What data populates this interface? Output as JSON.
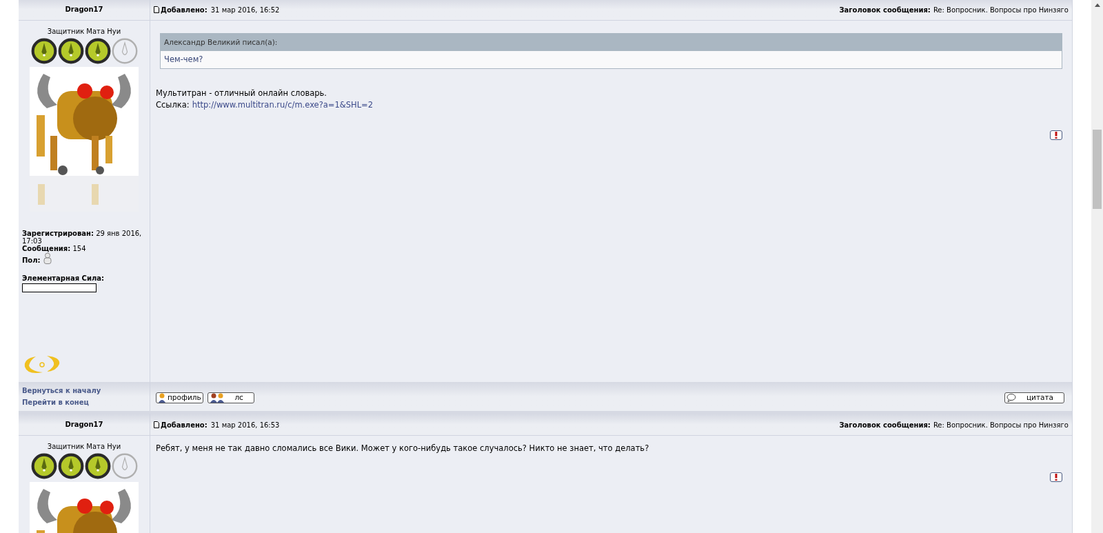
{
  "posts": [
    {
      "author": "Dragon17",
      "rank_title": "Защитник Мата Нуи",
      "rank_orbs": [
        {
          "lit": true
        },
        {
          "lit": true
        },
        {
          "lit": true
        },
        {
          "lit": false
        }
      ],
      "posted_label": "Добавлено:",
      "posted": "31 мар 2016, 16:52",
      "subject_label": "Заголовок сообщения:",
      "subject": "Re: Вопросник. Вопросы про Нинзяго",
      "profile": [
        {
          "label": "Зарегистрирован:",
          "value": "29 янв 2016, 17:03"
        },
        {
          "label": "Сообщения:",
          "value": "154"
        },
        {
          "label": "Пол:",
          "kind": "icon"
        }
      ],
      "power_label": "Элементарная Сила:",
      "quote": {
        "author": "Александр Великий писал(а):",
        "text": "Чем-чем?"
      },
      "body": [
        "Мультитран - отличный онлайн словарь."
      ],
      "link": {
        "label": "Ссылка:",
        "url": "http://www.multitran.ru/c/m.exe?a=1&SHL=2"
      },
      "footer_links": [
        "Вернуться к началу",
        "Перейти в конец"
      ],
      "buttons": [
        {
          "label": "профиль",
          "kind": "profile"
        },
        {
          "label": "лс",
          "kind": "pm"
        }
      ],
      "quote_button": "цитата"
    },
    {
      "author": "Dragon17",
      "rank_title": "Защитник Мата Нуи",
      "rank_orbs": [
        {
          "lit": true
        },
        {
          "lit": true
        },
        {
          "lit": true
        },
        {
          "lit": false
        }
      ],
      "posted_label": "Добавлено:",
      "posted": "31 мар 2016, 16:53",
      "subject_label": "Заголовок сообщения:",
      "subject": "Re: Вопросник. Вопросы про Нинзяго",
      "body": [
        "Ребят, у меня не так давно сломались все Вики. Может у кого-нибудь такое случалось? Никто не знает, что делать?"
      ]
    }
  ]
}
